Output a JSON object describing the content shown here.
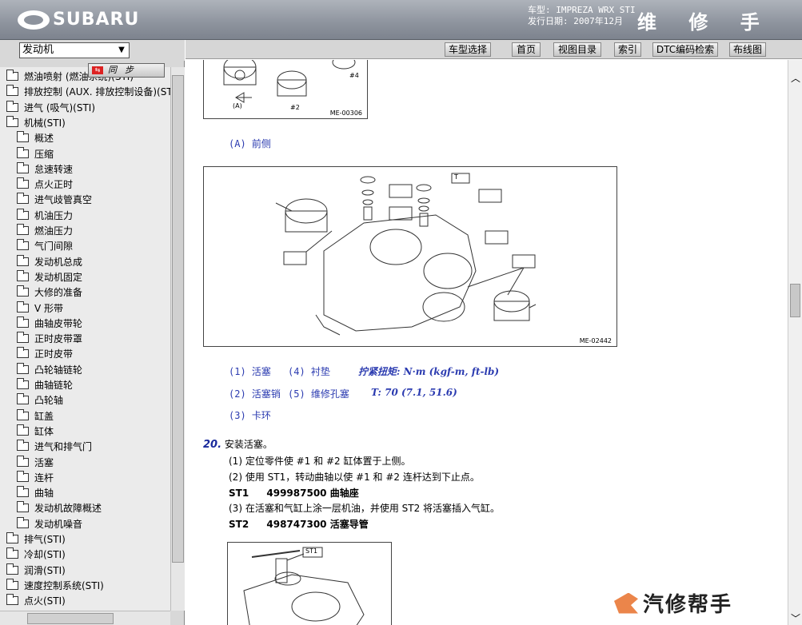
{
  "header": {
    "logo_text": "SUBARU",
    "car_model_label": "车型: IMPREZA WRX STI",
    "issue_date_label": "发行日期: 2007年12月",
    "manual_title": "维 修 手 册"
  },
  "sidebar": {
    "section_value": "发动机",
    "sync_label": "同步",
    "sync_flag": "步",
    "tree": [
      {
        "label": "燃油喷射 (燃油系统)(STI)",
        "level": 0
      },
      {
        "label": "排放控制 (AUX. 排放控制设备)(STI)",
        "level": 0
      },
      {
        "label": "进气 (吸气)(STI)",
        "level": 0
      },
      {
        "label": "机械(STI)",
        "level": 0
      },
      {
        "label": "概述",
        "level": 1
      },
      {
        "label": "压缩",
        "level": 1
      },
      {
        "label": "怠速转速",
        "level": 1
      },
      {
        "label": "点火正时",
        "level": 1
      },
      {
        "label": "进气歧管真空",
        "level": 1
      },
      {
        "label": "机油压力",
        "level": 1
      },
      {
        "label": "燃油压力",
        "level": 1
      },
      {
        "label": "气门间隙",
        "level": 1
      },
      {
        "label": "发动机总成",
        "level": 1
      },
      {
        "label": "发动机固定",
        "level": 1
      },
      {
        "label": "大修的准备",
        "level": 1
      },
      {
        "label": "V 形带",
        "level": 1
      },
      {
        "label": "曲轴皮带轮",
        "level": 1
      },
      {
        "label": "正时皮带罩",
        "level": 1
      },
      {
        "label": "正时皮带",
        "level": 1
      },
      {
        "label": "凸轮轴链轮",
        "level": 1
      },
      {
        "label": "曲轴链轮",
        "level": 1
      },
      {
        "label": "凸轮轴",
        "level": 1
      },
      {
        "label": "缸盖",
        "level": 1
      },
      {
        "label": "缸体",
        "level": 1
      },
      {
        "label": "进气和排气门",
        "level": 1
      },
      {
        "label": "活塞",
        "level": 1
      },
      {
        "label": "连杆",
        "level": 1
      },
      {
        "label": "曲轴",
        "level": 1
      },
      {
        "label": "发动机故障概述",
        "level": 1
      },
      {
        "label": "发动机噪音",
        "level": 1
      },
      {
        "label": "排气(STI)",
        "level": 0
      },
      {
        "label": "冷却(STI)",
        "level": 0
      },
      {
        "label": "润滑(STI)",
        "level": 0
      },
      {
        "label": "速度控制系统(STI)",
        "level": 0
      },
      {
        "label": "点火(STI)",
        "level": 0
      }
    ]
  },
  "toolbar": {
    "buttons": [
      "车型选择",
      "首页",
      "视图目录",
      "索引",
      "DTC编码检索",
      "布线图"
    ]
  },
  "content": {
    "fig1_code": "ME-00306",
    "fig1_labels": {
      "a": "(A)",
      "p2": "#2",
      "p4": "#4"
    },
    "caption_front": "(A) 前侧",
    "fig2_code": "ME-02442",
    "fig2_t_label": "T",
    "legend_row1_a": "(1) 活塞",
    "legend_row1_b": "(4) 衬垫",
    "torque_title": "拧紧扭矩: N·m (kgf-m, ft-lb)",
    "legend_row2_a": "(2) 活塞销",
    "legend_row2_b": "(5) 维修孔塞",
    "torque_value": "T:   70 (7.1, 51.6)",
    "legend_row3_a": "(3) 卡环",
    "step_number": "20.",
    "step_title": "安装活塞。",
    "sub1": "(1) 定位零件使 #1 和 #2 缸体置于上侧。",
    "sub2": "(2) 使用 ST1，转动曲轴以使 #1 和 #2 连杆达到下止点。",
    "st1_code": "ST1",
    "st1_part": "499987500 曲轴座",
    "sub3": "(3) 在活塞和气缸上涂一层机油，并使用 ST2 将活塞插入气缸。",
    "st2_code": "ST2",
    "st2_part": "498747300 活塞导管",
    "fig3_label": "ST1"
  },
  "watermark": {
    "text": "汽修帮手"
  }
}
